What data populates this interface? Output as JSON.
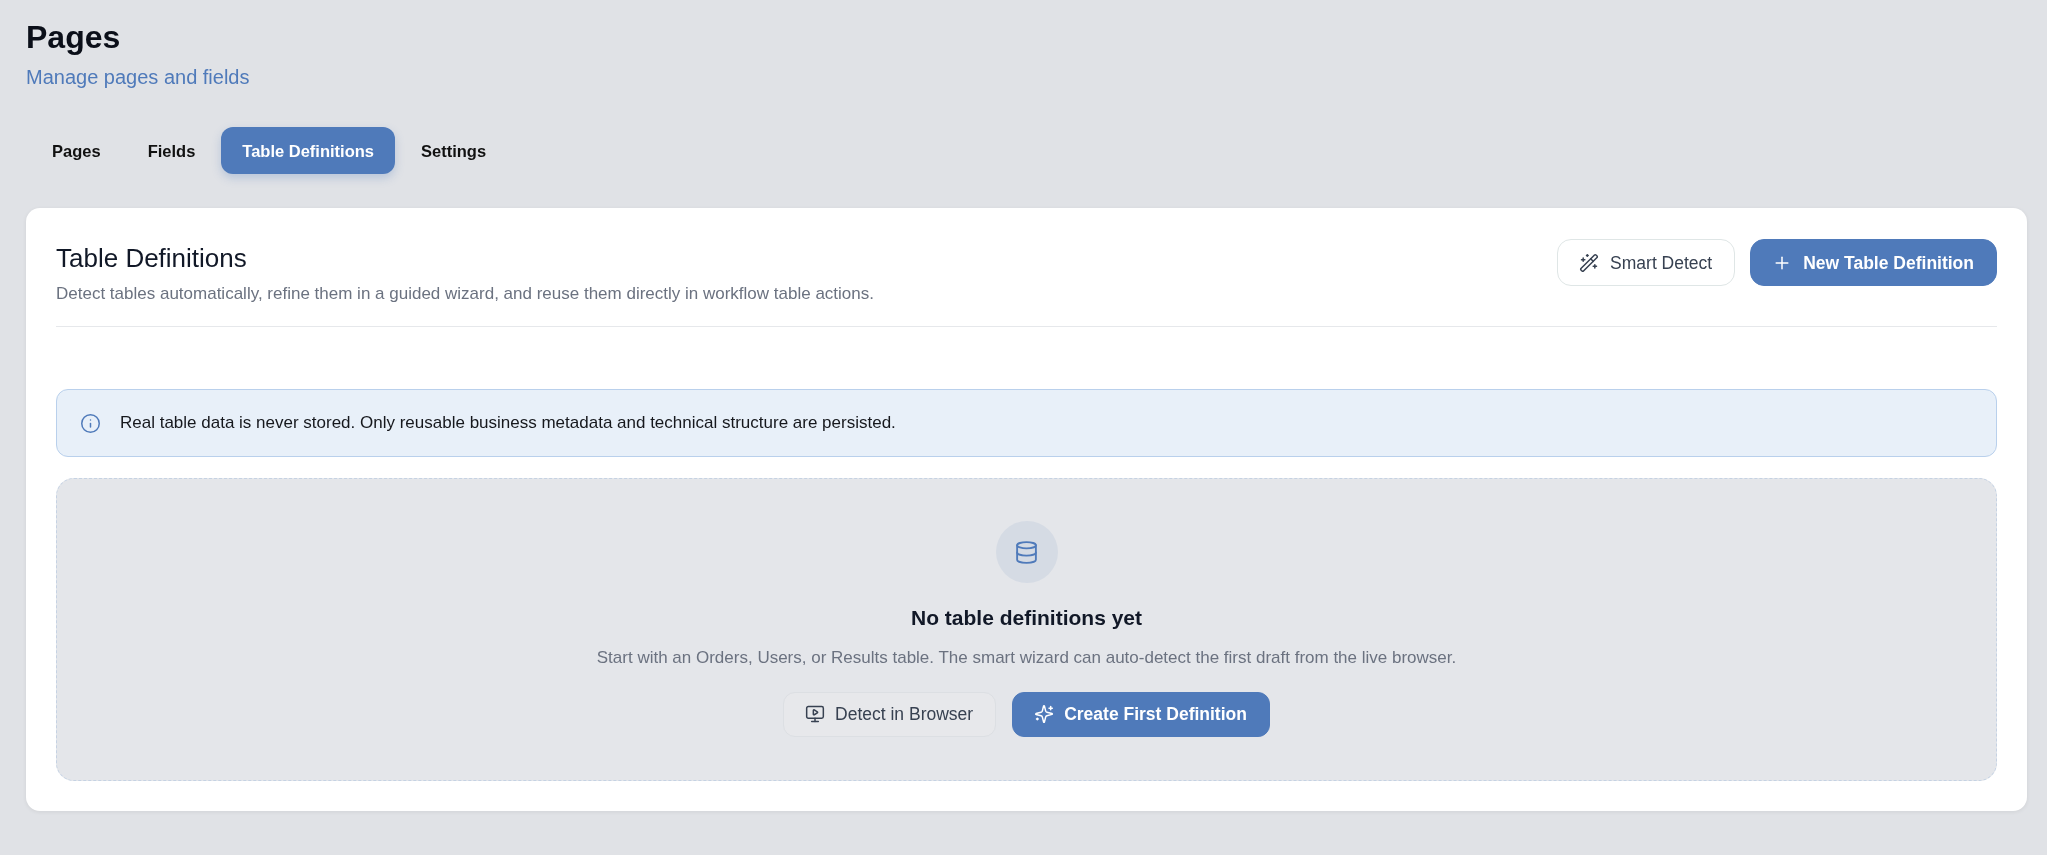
{
  "header": {
    "title": "Pages",
    "subtitle": "Manage pages and fields"
  },
  "tabs": [
    {
      "label": "Pages",
      "selected": false
    },
    {
      "label": "Fields",
      "selected": false
    },
    {
      "label": "Table Definitions",
      "selected": true
    },
    {
      "label": "Settings",
      "selected": false
    }
  ],
  "panel": {
    "title": "Table Definitions",
    "description": "Detect tables automatically, refine them in a guided wizard, and reuse them directly in workflow table actions.",
    "actions": [
      {
        "label": "Smart Detect",
        "kind": "secondary"
      },
      {
        "label": "New Table Definition",
        "kind": "primary"
      }
    ]
  },
  "notice": {
    "text": "Real table data is never stored. Only reusable business metadata and technical structure are persisted."
  },
  "empty_state": {
    "title": "No table definitions yet",
    "description": "Start with an Orders, Users, or Results table. The smart wizard can auto-detect the first draft from the live browser.",
    "actions": [
      {
        "label": "Detect in Browser",
        "kind": "secondary"
      },
      {
        "label": "Create First Definition",
        "kind": "primary"
      }
    ]
  }
}
